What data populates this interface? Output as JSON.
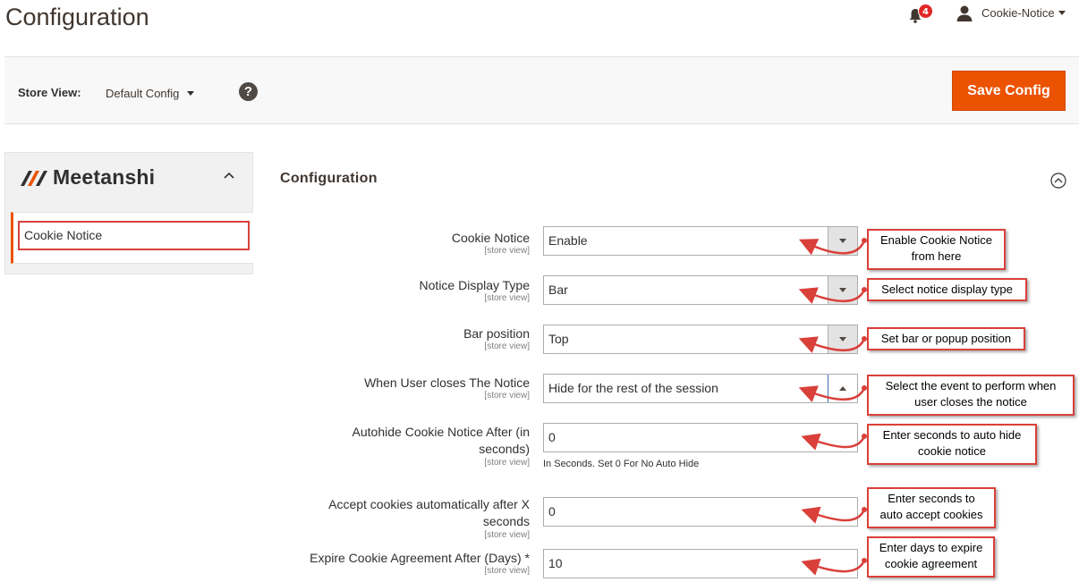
{
  "header": {
    "title": "Configuration",
    "notifications_count": "4",
    "user_name": "Cookie-Notice"
  },
  "toolbar": {
    "store_view_label": "Store View:",
    "store_view_value": "Default Config",
    "help_symbol": "?",
    "save_label": "Save Config"
  },
  "sidebar": {
    "brand": "Meetanshi",
    "items": [
      {
        "label": "Cookie Notice"
      }
    ]
  },
  "section": {
    "title": "Configuration"
  },
  "fields": [
    {
      "label": "Cookie Notice",
      "scope": "[store view]",
      "value": "Enable",
      "type": "select"
    },
    {
      "label": "Notice Display Type",
      "scope": "[store view]",
      "value": "Bar",
      "type": "select"
    },
    {
      "label": "Bar position",
      "scope": "[store view]",
      "value": "Top",
      "type": "select"
    },
    {
      "label": "When User closes The Notice",
      "scope": "[store view]",
      "value": "Hide for the rest of the session",
      "type": "select"
    },
    {
      "label_line1": "Autohide Cookie Notice After (in",
      "label_line2": "seconds)",
      "scope": "[store view]",
      "value": "0",
      "type": "text",
      "note": "In Seconds. Set 0 For No Auto Hide"
    },
    {
      "label_line1": "Accept cookies automatically after X",
      "label_line2": "seconds",
      "scope": "[store view]",
      "value": "0",
      "type": "text"
    },
    {
      "label": "Expire Cookie Agreement After (Days) *",
      "scope": "[store view]",
      "value": "10",
      "type": "text"
    }
  ],
  "callouts": [
    {
      "line1": "Enable Cookie Notice",
      "line2": "from here"
    },
    {
      "line1": "Select notice display type"
    },
    {
      "line1": "Set bar or popup position"
    },
    {
      "line1": "Select the event to perform when",
      "line2": "user closes the notice"
    },
    {
      "line1": "Enter seconds to auto hide",
      "line2": "cookie notice"
    },
    {
      "line1": "Enter seconds to",
      "line2": "auto accept cookies"
    },
    {
      "line1": "Enter days to expire",
      "line2": "cookie agreement"
    }
  ],
  "colors": {
    "accent": "#eb5202",
    "callout_border": "#d9403a",
    "badge": "#e22626"
  }
}
